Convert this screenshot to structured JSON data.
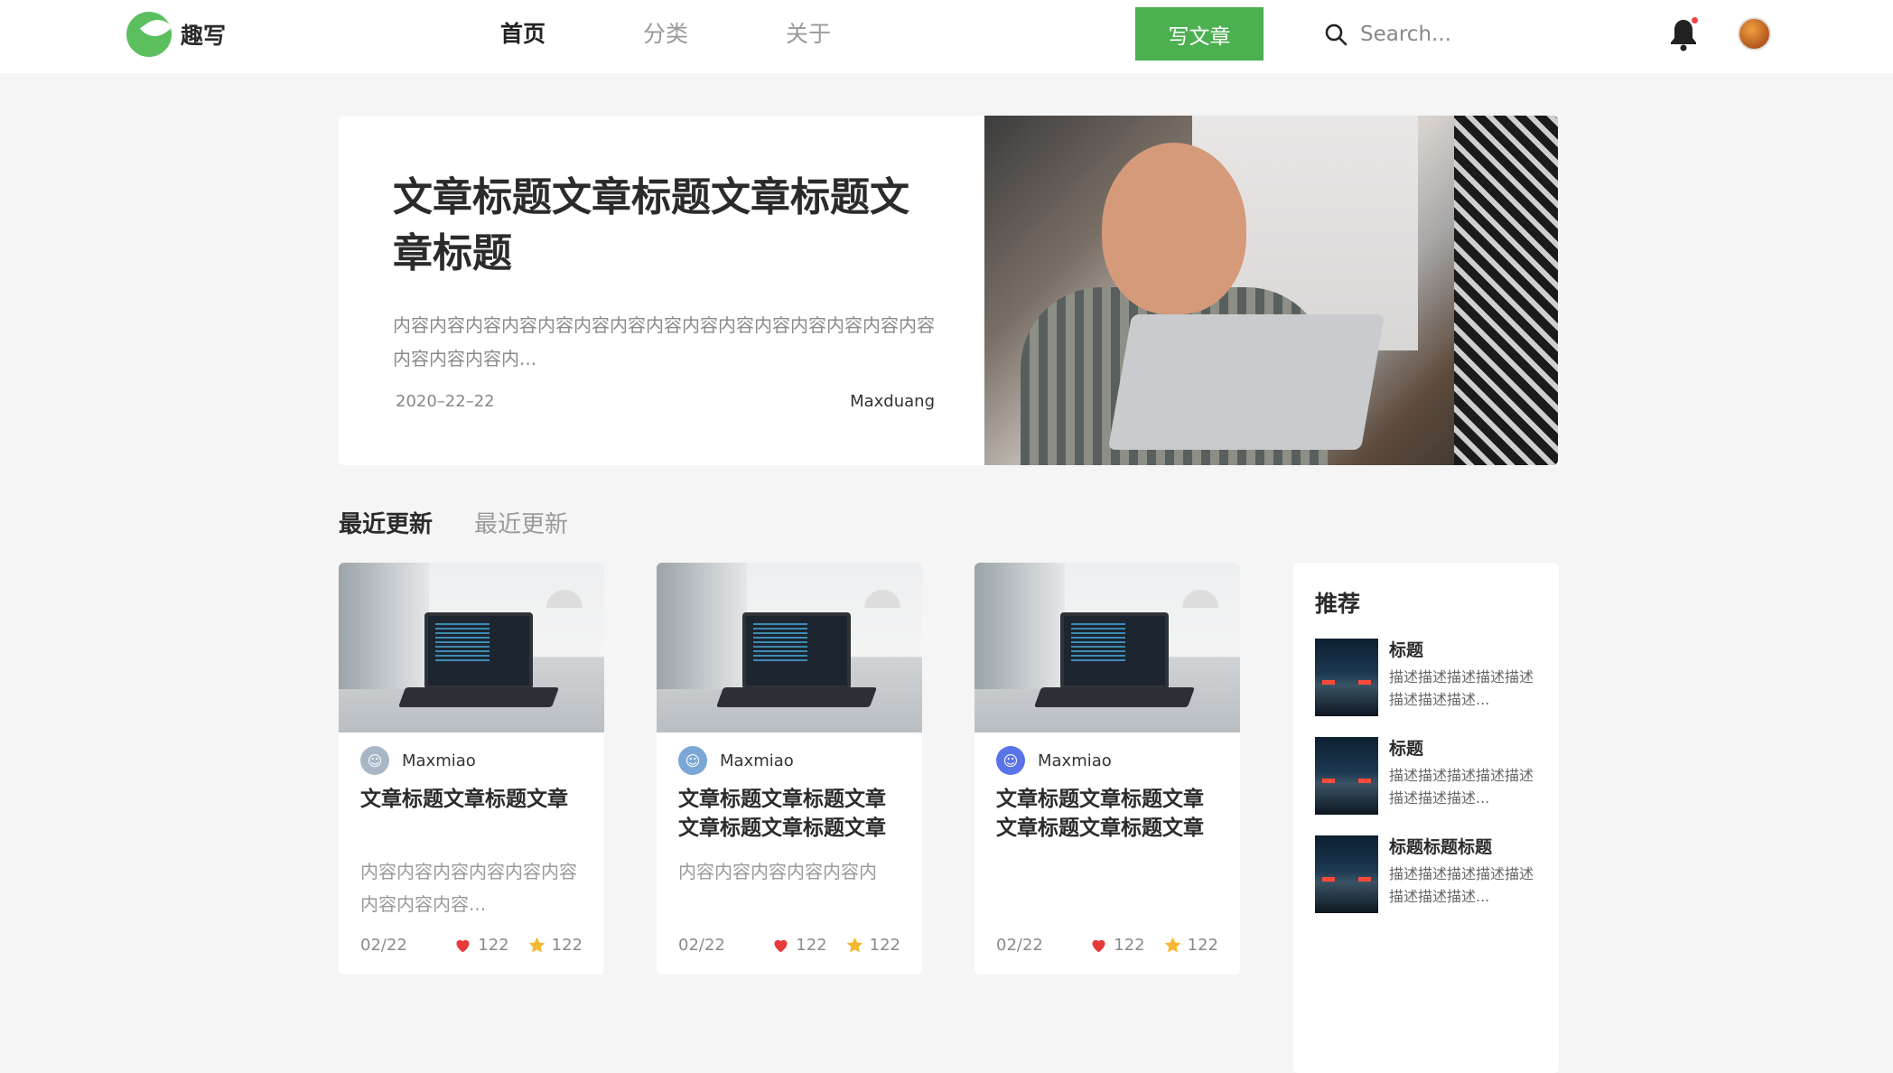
{
  "header": {
    "logo_text": "趣写",
    "nav": [
      {
        "label": "首页",
        "active": true
      },
      {
        "label": "分类",
        "active": false
      },
      {
        "label": "关于",
        "active": false
      }
    ],
    "write_button": "写文章",
    "search_placeholder": "Search..."
  },
  "hero": {
    "title": "文章标题文章标题文章标题文章标题",
    "excerpt": "内容内容内容内容内容内容内容内容内容内容内容内容内容内容内容内容内容内容内...",
    "date": "2020–22–22",
    "author": "Maxduang"
  },
  "section_tabs": [
    {
      "label": "最近更新",
      "active": true
    },
    {
      "label": "最近更新",
      "active": false
    }
  ],
  "cards": [
    {
      "author": "Maxmiao",
      "title": "文章标题文章标题文章",
      "excerpt": "内容内容内容内容内容内容内容内容内容...",
      "date": "02/22",
      "likes": "122",
      "stars": "122"
    },
    {
      "author": "Maxmiao",
      "title": "文章标题文章标题文章文章标题文章标题文章",
      "excerpt": "内容内容内容内容内容内",
      "date": "02/22",
      "likes": "122",
      "stars": "122"
    },
    {
      "author": "Maxmiao",
      "title": "文章标题文章标题文章文章标题文章标题文章",
      "excerpt": "",
      "date": "02/22",
      "likes": "122",
      "stars": "122"
    }
  ],
  "recommend": {
    "title": "推荐",
    "items": [
      {
        "name": "标题",
        "desc": "描述描述描述描述描述描述描述描述..."
      },
      {
        "name": "标题",
        "desc": "描述描述描述描述描述描述描述描述..."
      },
      {
        "name": "标题标题标题",
        "desc": "描述描述描述描述描述描述描述描述..."
      }
    ]
  },
  "colors": {
    "accent": "#4caf50",
    "heart": "#e83a3a",
    "star": "#f5b731"
  }
}
